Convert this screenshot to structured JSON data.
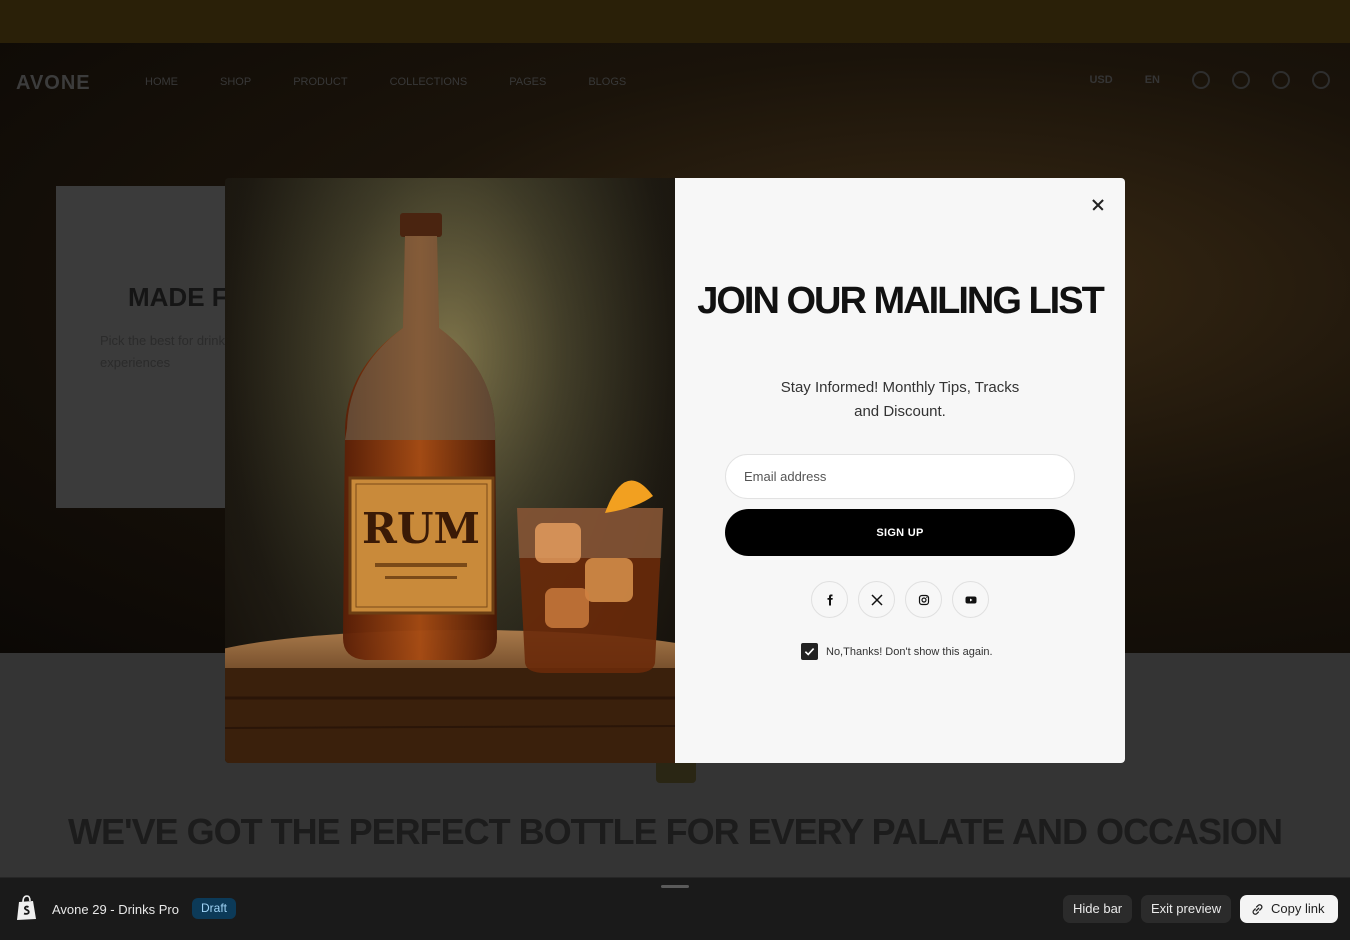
{
  "background": {
    "logo": "AVONE",
    "nav": [
      "HOME",
      "SHOP",
      "PRODUCT",
      "COLLECTIONS",
      "PAGES",
      "BLOGS"
    ],
    "header_right": [
      "USD",
      "EN"
    ],
    "hero_title": "MADE F",
    "hero_subtitle": "Pick the best for drinks, experiences",
    "section_heading": "WE'VE GOT THE PERFECT BOTTLE FOR EVERY PALATE AND OCCASION"
  },
  "modal": {
    "title": "JOIN OUR MAILING LIST",
    "subtitle": "Stay Informed! Monthly Tips, Tracks and Discount.",
    "email_placeholder": "Email address",
    "signup_label": "SIGN UP",
    "socials": [
      "facebook-icon",
      "x-icon",
      "instagram-icon",
      "youtube-icon"
    ],
    "dont_show_label": "No,Thanks! Don't show this again.",
    "dont_show_checked": true,
    "image": {
      "label": "RUM"
    }
  },
  "preview_bar": {
    "store_name": "Avone 29 - Drinks Pro",
    "status": "Draft",
    "hide_bar": "Hide bar",
    "exit_preview": "Exit preview",
    "copy_link": "Copy link"
  }
}
